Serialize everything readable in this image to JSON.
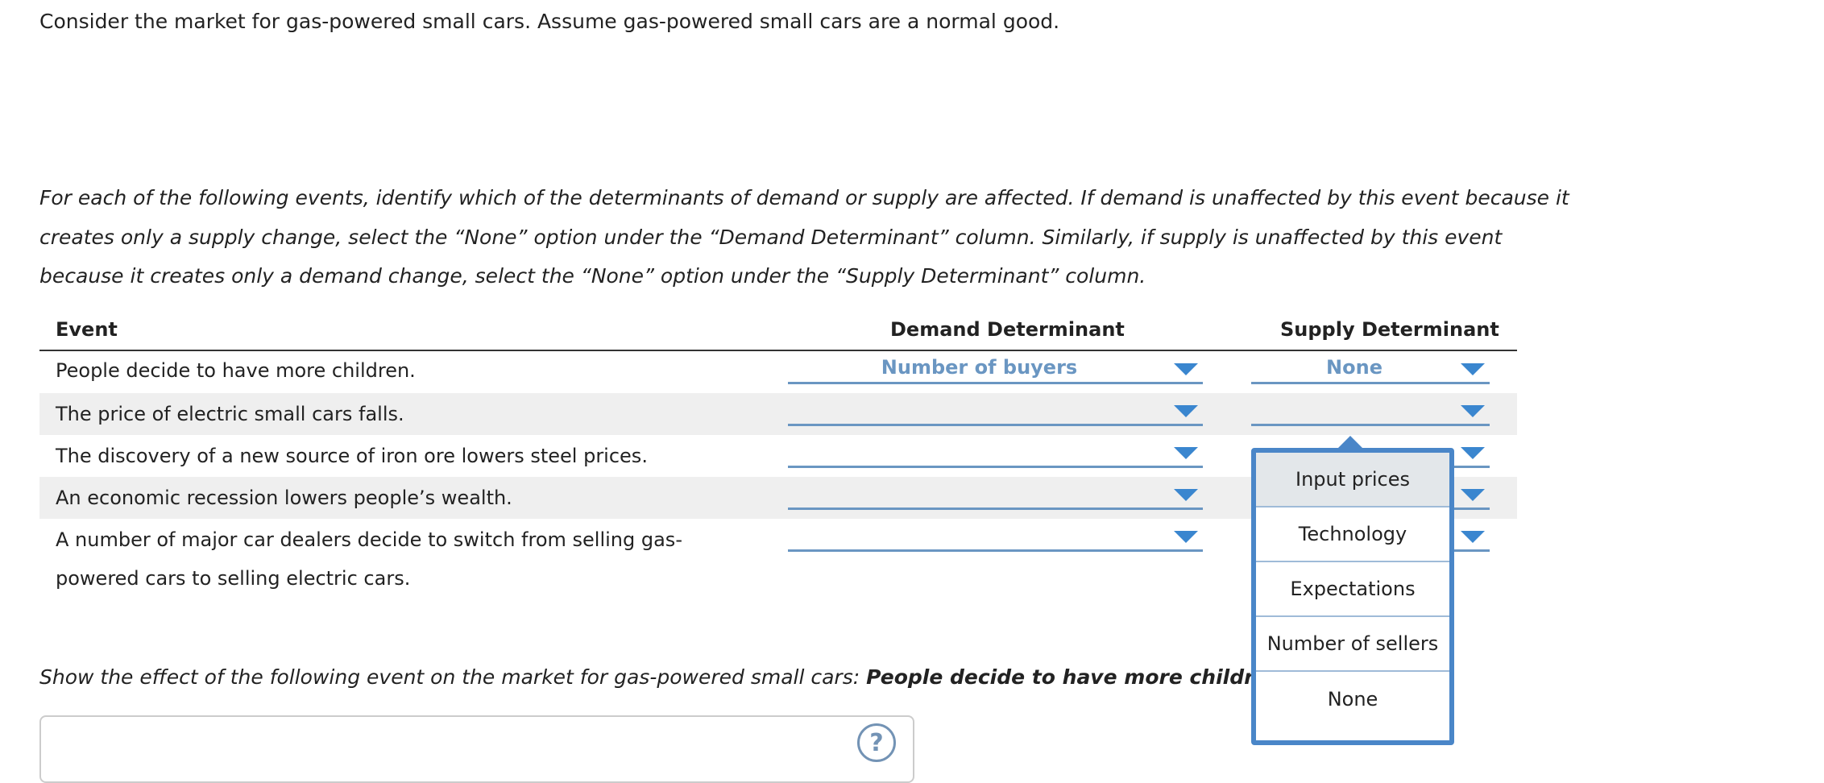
{
  "intro_text": "Consider the market for gas-powered small cars. Assume gas-powered small cars are a normal good.",
  "instructions": {
    "line1": "For each of the following events, identify which of the determinants of demand or supply are affected. If demand is unaffected by this event because it",
    "line2": "creates only a supply change, select the “None” option under the “Demand Determinant” column. Similarly, if supply is unaffected by this event",
    "line3": "because it creates only a demand change, select the “None” option under the “Supply Determinant” column."
  },
  "table": {
    "headers": {
      "event": "Event",
      "demand": "Demand Determinant",
      "supply": "Supply Determinant"
    },
    "rows": [
      {
        "event": "People decide to have more children.",
        "demand": "Number of buyers",
        "supply": "None"
      },
      {
        "event": "The price of electric small cars falls.",
        "demand": "",
        "supply": ""
      },
      {
        "event": "The discovery of a new source of iron ore lowers steel prices.",
        "demand": "",
        "supply": ""
      },
      {
        "event": "An economic recession lowers people’s wealth.",
        "demand": "",
        "supply": ""
      },
      {
        "event_line1": "A number of major car dealers decide to switch from selling gas-",
        "event_line2": "powered cars to selling electric cars.",
        "demand": "",
        "supply": ""
      }
    ]
  },
  "supply_menu": {
    "options": [
      "Input prices",
      "Technology",
      "Expectations",
      "Number of sellers",
      "None"
    ],
    "highlighted": "Input prices"
  },
  "effect": {
    "prefix": "Show the effect of the following event on the market for gas-powered small cars: ",
    "event": "People decide to have more children."
  },
  "help_icon": "?",
  "colors": {
    "accent": "#6a96c2",
    "arrow": "#3a86cf",
    "menu_border": "#4a86c8",
    "row_shade": "#efefef"
  }
}
